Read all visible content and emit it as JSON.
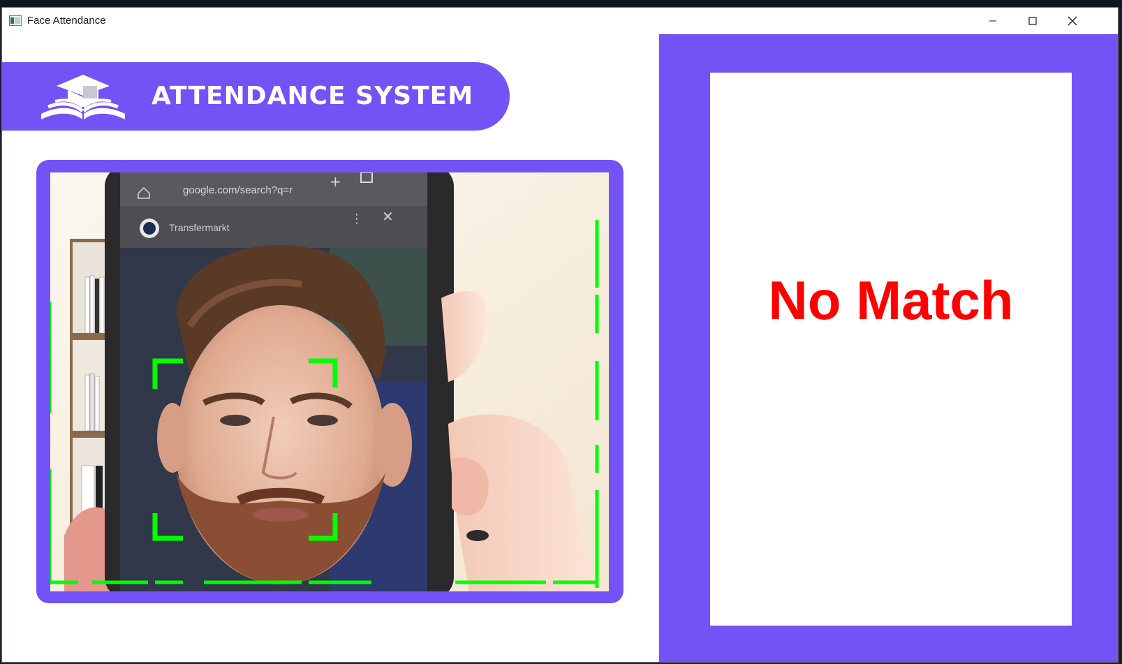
{
  "window": {
    "title": "Face Attendance",
    "controls": [
      "minimize-icon",
      "maximize-icon",
      "close-icon"
    ]
  },
  "banner": {
    "title": "ATTENDANCE SYSTEM",
    "icon": "graduation-cap-book-icon",
    "color": "#7353f6"
  },
  "camera": {
    "browser_url": "google.com/search?q=r",
    "tab_site": "Transfermarkt",
    "tracking_color": "#00ff00"
  },
  "result": {
    "status": "No Match",
    "color": "#ff0000"
  }
}
